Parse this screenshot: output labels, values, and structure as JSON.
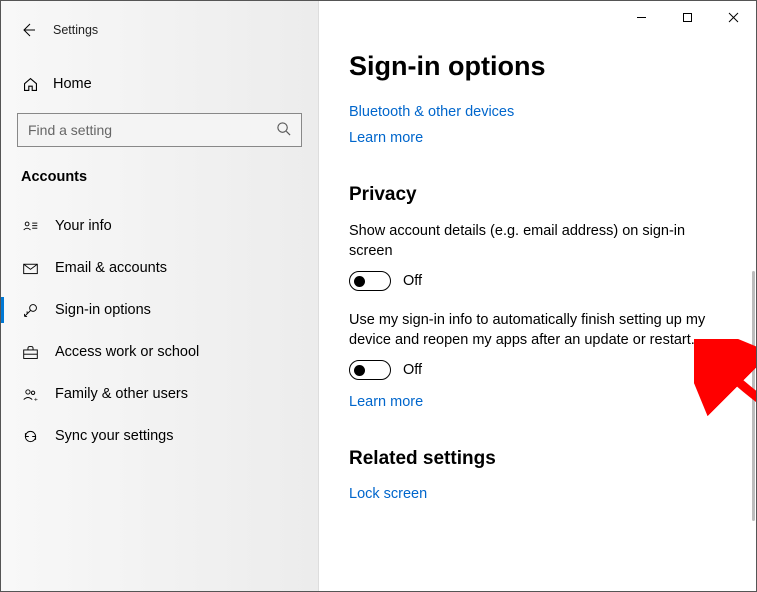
{
  "app": {
    "title": "Settings"
  },
  "home": {
    "label": "Home"
  },
  "search": {
    "placeholder": "Find a setting"
  },
  "sidebar": {
    "section": "Accounts",
    "items": [
      {
        "label": "Your info"
      },
      {
        "label": "Email & accounts"
      },
      {
        "label": "Sign-in options"
      },
      {
        "label": "Access work or school"
      },
      {
        "label": "Family & other users"
      },
      {
        "label": "Sync your settings"
      }
    ],
    "active_index": 2
  },
  "main": {
    "title": "Sign-in options",
    "links": {
      "bluetooth": "Bluetooth & other devices",
      "learn_more_top": "Learn more",
      "learn_more_mid": "Learn more",
      "lock_screen": "Lock screen"
    },
    "sections": {
      "privacy": {
        "title": "Privacy",
        "setting1": {
          "desc": "Show account details (e.g. email address) on sign-in screen",
          "state": "Off",
          "on": false
        },
        "setting2": {
          "desc": "Use my sign-in info to automatically finish setting up my device and reopen my apps after an update or restart.",
          "state": "Off",
          "on": false
        }
      },
      "related": {
        "title": "Related settings"
      }
    }
  }
}
